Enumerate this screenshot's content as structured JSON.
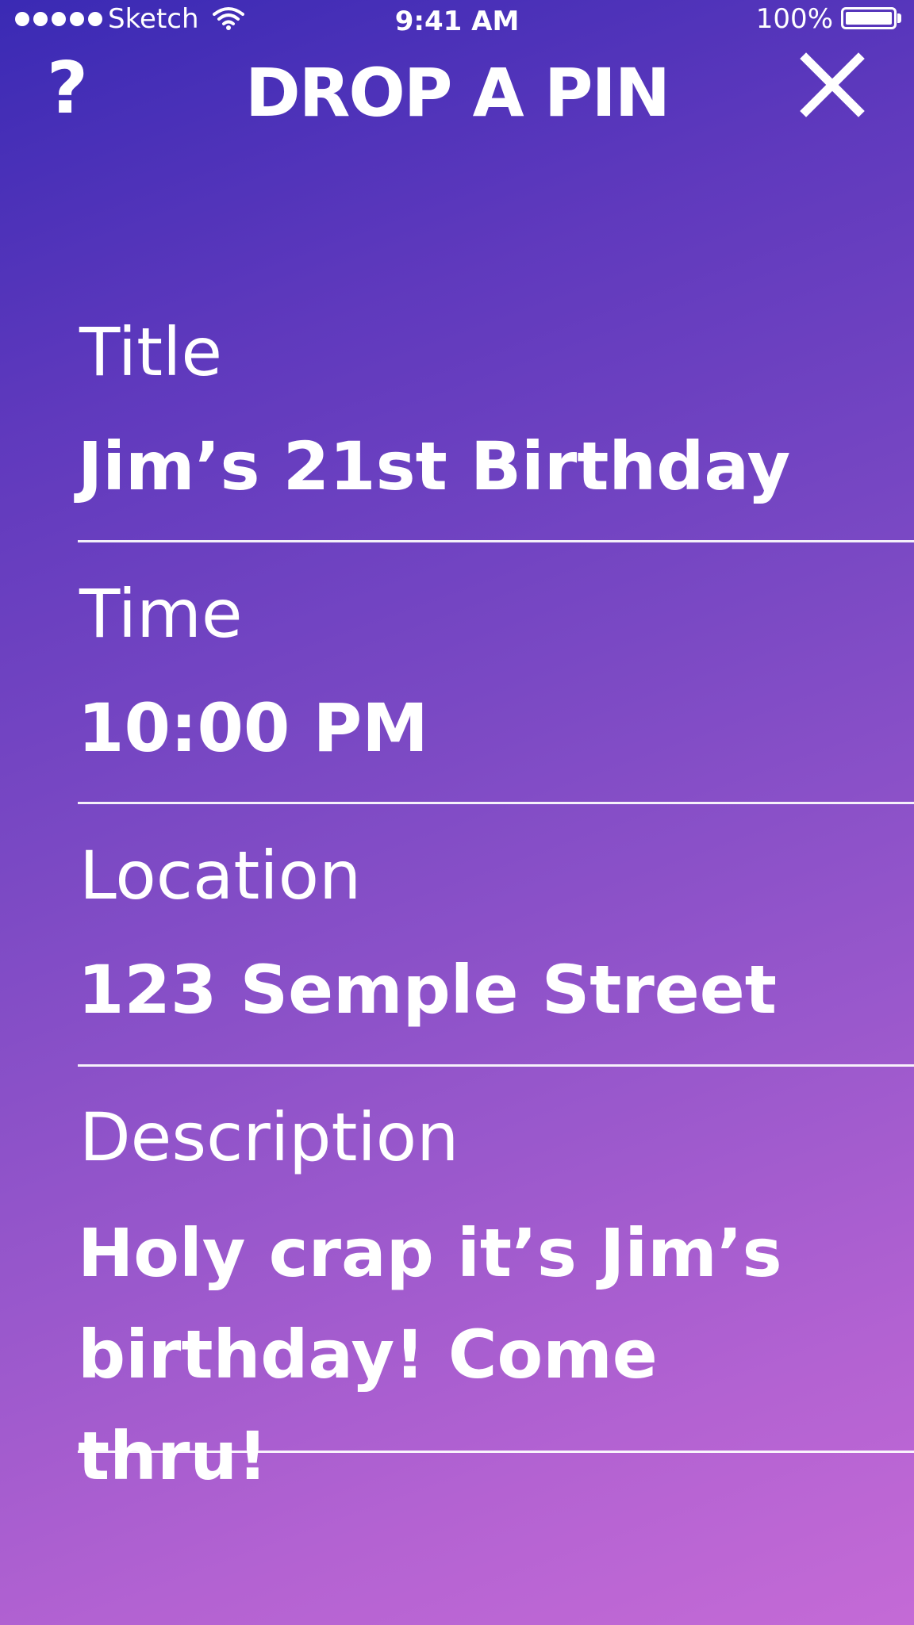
{
  "status_bar": {
    "signal_bars": 5,
    "carrier": "Sketch",
    "wifi_icon": "wifi-icon",
    "time": "9:41 AM",
    "battery_percent": "100%",
    "battery_level": 1.0
  },
  "header": {
    "help_label": "?",
    "title": "DROP A PIN",
    "close_icon": "close-icon"
  },
  "form": {
    "fields": [
      {
        "label": "Title",
        "value": "Jim’s 21st Birthday"
      },
      {
        "label": "Time",
        "value": "10:00 PM"
      },
      {
        "label": "Location",
        "value": "123 Semple Street"
      },
      {
        "label": "Description",
        "value": "Holy crap it’s Jim’s birthday! Come thru!"
      }
    ]
  },
  "colors": {
    "gradient_start": "#3a2ab4",
    "gradient_end": "#c46ad6",
    "text": "#ffffff"
  }
}
